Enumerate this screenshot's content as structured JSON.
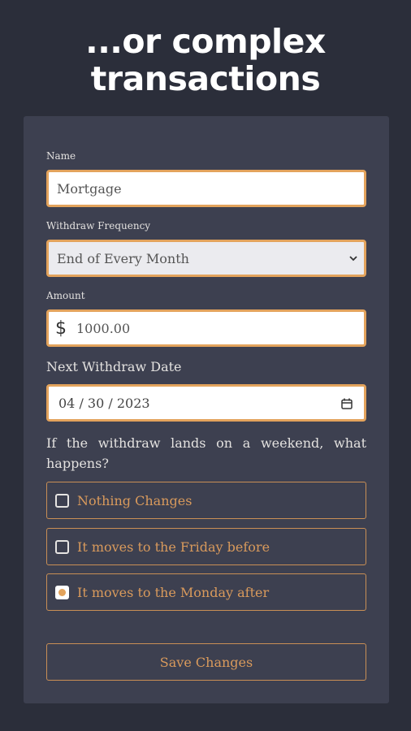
{
  "headline": {
    "line1": "...or complex",
    "line2": "transactions"
  },
  "form": {
    "name": {
      "label": "Name",
      "value": "Mortgage"
    },
    "frequency": {
      "label": "Withdraw Frequency",
      "selected": "End of Every Month"
    },
    "amount": {
      "label": "Amount",
      "currency_symbol": "$",
      "value": "1000.00"
    },
    "next_date": {
      "label": "Next Withdraw Date",
      "value": "04 / 30 / 2023"
    },
    "weekend": {
      "question": "If the withdraw lands on a weekend, what happens?",
      "options": [
        {
          "label": "Nothing Changes",
          "checked": false
        },
        {
          "label": "It moves to the Friday before",
          "checked": false
        },
        {
          "label": "It moves to the Monday after",
          "checked": true
        }
      ]
    },
    "save_label": "Save Changes"
  },
  "colors": {
    "background": "#2b2e3a",
    "card": "#3d4050",
    "accent": "#e3a35c"
  },
  "icons": {
    "chevron": "chevron-down-icon",
    "calendar": "calendar-icon"
  }
}
